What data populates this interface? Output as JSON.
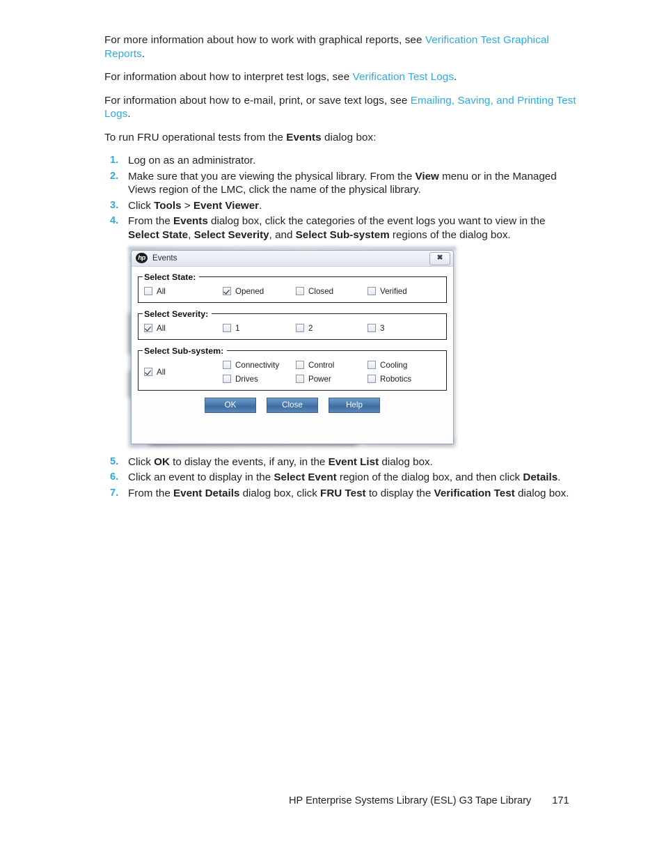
{
  "document": {
    "paragraphs": [
      {
        "id": "p1",
        "parts": [
          {
            "type": "text",
            "value": "For more information about how to work with graphical reports, see "
          },
          {
            "type": "link",
            "value": "Verification Test Graphical Reports"
          },
          {
            "type": "text",
            "value": "."
          }
        ]
      },
      {
        "id": "p2",
        "parts": [
          {
            "type": "text",
            "value": "For information about how to interpret test logs, see "
          },
          {
            "type": "link",
            "value": "Verification Test Logs"
          },
          {
            "type": "text",
            "value": "."
          }
        ]
      },
      {
        "id": "p3",
        "parts": [
          {
            "type": "text",
            "value": "For information about how to e-mail, print, or save text logs, see "
          },
          {
            "type": "link",
            "value": "Emailing, Saving, and Printing Test Logs"
          },
          {
            "type": "text",
            "value": "."
          }
        ]
      },
      {
        "id": "p4",
        "parts": [
          {
            "type": "text",
            "value": "To run FRU operational tests from the "
          },
          {
            "type": "bold",
            "value": "Events"
          },
          {
            "type": "text",
            "value": " dialog box:"
          }
        ]
      }
    ],
    "steps_before": [
      {
        "number": "1.",
        "parts": [
          {
            "type": "text",
            "value": "Log on as an administrator."
          }
        ]
      },
      {
        "number": "2.",
        "parts": [
          {
            "type": "text",
            "value": "Make sure that you are viewing the physical library. From the "
          },
          {
            "type": "bold",
            "value": "View"
          },
          {
            "type": "text",
            "value": " menu or in the Managed Views region of the LMC, click the name of the physical library."
          }
        ]
      },
      {
        "number": "3.",
        "parts": [
          {
            "type": "text",
            "value": "Click "
          },
          {
            "type": "bold",
            "value": "Tools"
          },
          {
            "type": "text",
            "value": " > "
          },
          {
            "type": "bold",
            "value": "Event Viewer"
          },
          {
            "type": "text",
            "value": "."
          }
        ]
      },
      {
        "number": "4.",
        "parts": [
          {
            "type": "text",
            "value": "From the "
          },
          {
            "type": "bold",
            "value": "Events"
          },
          {
            "type": "text",
            "value": " dialog box, click the categories of the event logs you want to view in the "
          },
          {
            "type": "bold",
            "value": "Select State"
          },
          {
            "type": "text",
            "value": ", "
          },
          {
            "type": "bold",
            "value": "Select Severity"
          },
          {
            "type": "text",
            "value": ", and "
          },
          {
            "type": "bold",
            "value": "Select Sub-system"
          },
          {
            "type": "text",
            "value": " regions of the dialog box."
          }
        ]
      }
    ],
    "steps_after": [
      {
        "number": "5.",
        "parts": [
          {
            "type": "text",
            "value": "Click "
          },
          {
            "type": "bold",
            "value": "OK"
          },
          {
            "type": "text",
            "value": " to dislay the events, if any, in the "
          },
          {
            "type": "bold",
            "value": "Event List"
          },
          {
            "type": "text",
            "value": " dialog box."
          }
        ]
      },
      {
        "number": "6.",
        "parts": [
          {
            "type": "text",
            "value": "Click an event to display in the "
          },
          {
            "type": "bold",
            "value": "Select Event"
          },
          {
            "type": "text",
            "value": " region of the dialog box, and then click "
          },
          {
            "type": "bold",
            "value": "Details"
          },
          {
            "type": "text",
            "value": "."
          }
        ]
      },
      {
        "number": "7.",
        "parts": [
          {
            "type": "text",
            "value": "From the "
          },
          {
            "type": "bold",
            "value": "Event Details"
          },
          {
            "type": "text",
            "value": " dialog box, click "
          },
          {
            "type": "bold",
            "value": "FRU Test"
          },
          {
            "type": "text",
            "value": " to display the "
          },
          {
            "type": "bold",
            "value": "Verification Test"
          },
          {
            "type": "text",
            "value": " dialog box."
          }
        ]
      }
    ]
  },
  "screenshot": {
    "dialog": {
      "title": "Events",
      "logo_text": "hp",
      "close_label": "✖",
      "groups": [
        {
          "id": "select-state",
          "legend": "Select State:",
          "layout": "single-row",
          "options": [
            {
              "label": "All",
              "checked": false
            },
            {
              "label": "Opened",
              "checked": true
            },
            {
              "label": "Closed",
              "checked": false
            },
            {
              "label": "Verified",
              "checked": false
            }
          ]
        },
        {
          "id": "select-severity",
          "legend": "Select Severity:",
          "layout": "single-row",
          "options": [
            {
              "label": "All",
              "checked": true
            },
            {
              "label": "1",
              "checked": false
            },
            {
              "label": "2",
              "checked": false
            },
            {
              "label": "3",
              "checked": false
            }
          ]
        },
        {
          "id": "select-subsystem",
          "legend": "Select Sub-system:",
          "layout": "all-plus-grid",
          "all_option": {
            "label": "All",
            "checked": true
          },
          "options": [
            {
              "label": "Connectivity",
              "checked": false
            },
            {
              "label": "Control",
              "checked": false
            },
            {
              "label": "Cooling",
              "checked": false
            },
            {
              "label": "Drives",
              "checked": false
            },
            {
              "label": "Power",
              "checked": false
            },
            {
              "label": "Robotics",
              "checked": false
            }
          ]
        }
      ],
      "buttons": [
        {
          "id": "ok",
          "label": "OK"
        },
        {
          "id": "close",
          "label": "Close"
        },
        {
          "id": "help",
          "label": "Help"
        }
      ]
    }
  },
  "footer": {
    "title": "HP Enterprise Systems Library (ESL) G3 Tape Library",
    "page_number": "171"
  },
  "colors": {
    "link": "#29abe2",
    "step_number": "#29abe2",
    "body_text": "#231f20",
    "button_blue": "#4a7aae"
  }
}
